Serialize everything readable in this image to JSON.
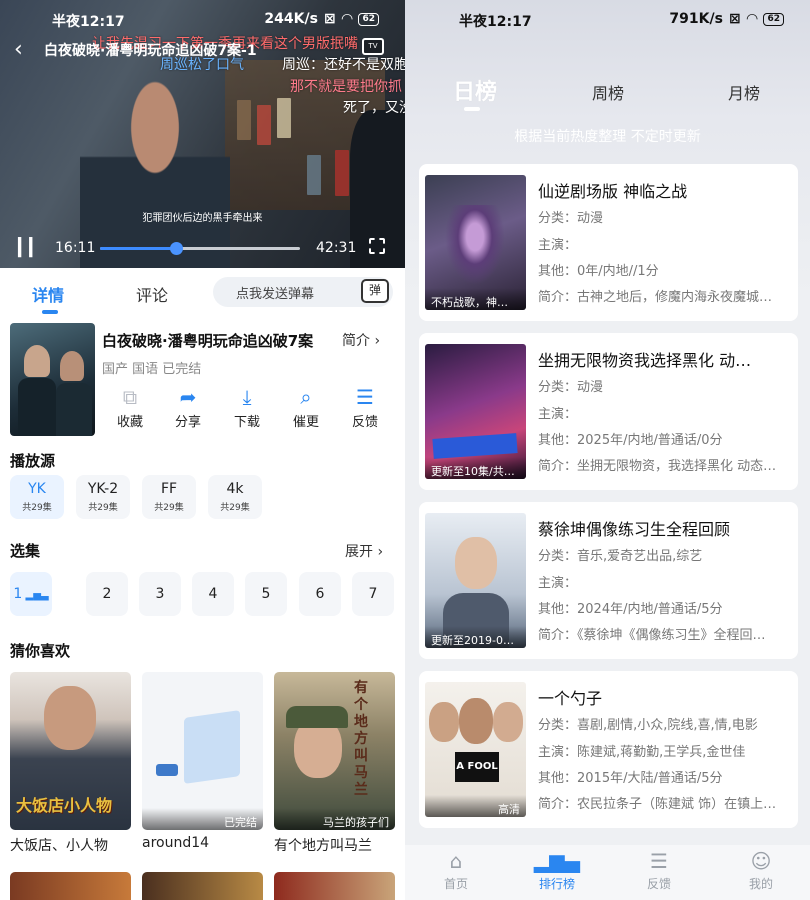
{
  "status_left": {
    "time": "半夜12:17",
    "speed": "244K/s",
    "battery": "62"
  },
  "status_right": {
    "time": "半夜12:17",
    "speed": "791K/s",
    "battery": "62"
  },
  "video": {
    "title": "白夜破晓·潘粤明玩命追凶破7案-1",
    "tv_label": "TV",
    "danmaku": [
      "让我先温习一下第一季再来看这个男版抿嘴",
      "周巡松了口气",
      "周巡：还好不是双胞",
      "那不就是要把你抓",
      "死了，又没"
    ],
    "subtitle": "犯罪团伙后边的黑手牵出来",
    "current_time": "16:11",
    "duration": "42:31",
    "progress": 0.38
  },
  "tabs": {
    "detail": "详情",
    "comments": "评论"
  },
  "danmu_input": {
    "placeholder": "点我发送弹幕",
    "icon_text": "弹"
  },
  "detail": {
    "title": "白夜破晓·潘粤明玩命追凶破7案",
    "intro_label": "简介",
    "meta": "国产 国语 已完结",
    "actions": [
      {
        "icon": "collect-icon",
        "label": "收藏"
      },
      {
        "icon": "share-icon",
        "label": "分享"
      },
      {
        "icon": "download-icon",
        "label": "下载"
      },
      {
        "icon": "urge-icon",
        "label": "催更"
      },
      {
        "icon": "feedback-icon",
        "label": "反馈"
      }
    ]
  },
  "sources": {
    "heading": "播放源",
    "items": [
      {
        "name": "YK",
        "count": "共29集"
      },
      {
        "name": "YK-2",
        "count": "共29集"
      },
      {
        "name": "FF",
        "count": "共29集"
      },
      {
        "name": "4k",
        "count": "共29集"
      }
    ]
  },
  "episodes": {
    "heading": "选集",
    "expand": "展开",
    "items": [
      "1",
      "2",
      "3",
      "4",
      "5",
      "6",
      "7"
    ]
  },
  "recommend": {
    "heading": "猜你喜欢",
    "items": [
      {
        "title": "大饭店、小人物",
        "poster_text": "大饭店小人物",
        "badge": ""
      },
      {
        "title": "around14",
        "poster_text": "",
        "badge": "已完结"
      },
      {
        "title": "有个地方叫马兰",
        "poster_text": "有个地方叫马兰",
        "badge": "马兰的孩子们"
      }
    ]
  },
  "ranking": {
    "tabs": [
      "日榜",
      "周榜",
      "月榜"
    ],
    "note": "根据当前热度整理 不定时更新",
    "items": [
      {
        "title": "仙逆剧场版 神临之战",
        "category": "分类：动漫",
        "cast": "主演：",
        "other": "其他：0年/内地//1分",
        "desc": "简介：古神之地后，修魔内海永夜魔城…",
        "label": "不朽战歌，神…"
      },
      {
        "title": "坐拥无限物资我选择黑化 动…",
        "category": "分类：动漫",
        "cast": "主演：",
        "other": "其他：2025年/内地/普通话/0分",
        "desc": "简介：坐拥无限物资，我选择黑化 动态…",
        "label": "更新至10集/共…"
      },
      {
        "title": "蔡徐坤偶像练习生全程回顾",
        "category": "分类：音乐,爱奇艺出品,综艺",
        "cast": "主演：",
        "other": "其他：2024年/内地/普通话/5分",
        "desc": "简介：《蔡徐坤《偶像练习生》全程回…",
        "label": "更新至2019-0…"
      },
      {
        "title": "一个勺子",
        "category": "分类：喜剧,剧情,小众,院线,喜,情,电影",
        "cast": "主演：陈建斌,蒋勤勤,王学兵,金世佳",
        "other": "其他：2015年/大陆/普通话/5分",
        "desc": "简介：农民拉条子（陈建斌 饰）在镇上…",
        "label": "高清"
      }
    ]
  },
  "nav": [
    {
      "icon": "home-icon",
      "label": "首页"
    },
    {
      "icon": "ranking-icon",
      "label": "排行榜"
    },
    {
      "icon": "feedback-icon",
      "label": "反馈"
    },
    {
      "icon": "profile-icon",
      "label": "我的"
    }
  ],
  "colors": {
    "accent": "#2a86f0"
  }
}
